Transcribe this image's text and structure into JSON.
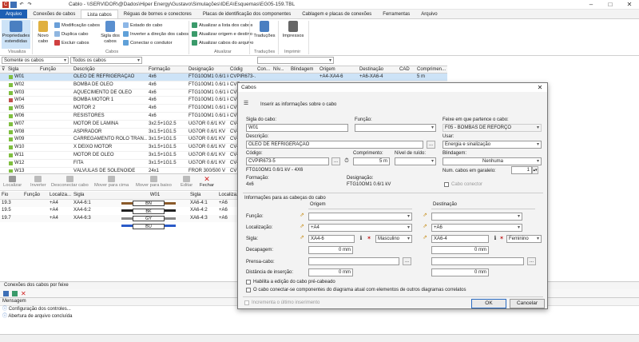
{
  "window": {
    "title": "Cablo - \\\\SERVIDOR\\@Dados\\Hiper Energy\\Gustavo\\Simulações\\IDEA\\Esquemas\\EG05-159.TBL"
  },
  "tabs": [
    "Arquivo",
    "Conexões de cabos",
    "Lista cabos",
    "Réguas de bornes e conectores",
    "Placas de identificação dos componentes",
    "Cablagem e placas de conexões",
    "Ferramentas",
    "Arquivo"
  ],
  "ribbon": {
    "props": "Propriedades estendidas",
    "new_cable": "Novo cabo",
    "mod": "Modificação cabos",
    "dup": "Duplica cabo",
    "del": "Excluir cabos",
    "sigla": "Sigla dos cabos",
    "state": "Estado do cabo",
    "invert": "Inverter a direção dos cabos",
    "connect": "Conectar o condutor",
    "upd_list": "Atualizar a lista dos cabos",
    "upd_orig": "Atualizar origem e destino",
    "upd_file": "Atualizar cabos do arquivo",
    "translations": "Traduções",
    "print": "Impressos",
    "g_view": "Visualiza",
    "g_cables": "Cabos",
    "g_update": "Atualizar",
    "g_trans": "Traduções",
    "g_print": "Imprimir"
  },
  "filters": {
    "left": "Somente os cabos",
    "right": "Todos os cabos"
  },
  "cable_columns": [
    "Sigla",
    "Função",
    "Descrição",
    "Formação",
    "Designação",
    "Códig",
    "Con...",
    "Nív...",
    "Blindagem",
    "Origem",
    "Destinação",
    "CAD",
    "Comprimen..."
  ],
  "cables": [
    {
      "sigla": "W01",
      "desc": "ÓLEO DE REFRIGERAÇÃO",
      "form": "4x6",
      "design": "FTG10OM1 0.6/1 kV",
      "cod": "CVPIR673-..",
      "orig": "+A4-XA4-6",
      "dest": "+A6-XA6-4",
      "len": "5 m",
      "color": "#7fbf3f"
    },
    {
      "sigla": "W02",
      "desc": "BOMBA DE ÓLEO",
      "form": "4x6",
      "design": "FTG10OM1 0.6/1 kV",
      "cod": "CVF",
      "orig": "",
      "dest": "",
      "len": "",
      "color": "#7fbf3f"
    },
    {
      "sigla": "W03",
      "desc": "AQUECIMENTO DE ÓLEO",
      "form": "4x6",
      "design": "FTG10OM1 0.6/1 kV",
      "cod": "CVF",
      "orig": "",
      "dest": "",
      "len": "",
      "color": "#7fbf3f"
    },
    {
      "sigla": "W04",
      "desc": "BOMBA MOTOR 1",
      "form": "4x6",
      "design": "FTG10OM1 0.6/1 kV",
      "cod": "CVF",
      "orig": "",
      "dest": "",
      "len": "",
      "color": "#c0504d"
    },
    {
      "sigla": "W05",
      "desc": "MOTOR 2",
      "form": "4x6",
      "design": "FTG10OM1 0.6/1 kV",
      "cod": "CVF",
      "orig": "",
      "dest": "",
      "len": "",
      "color": "#7fbf3f"
    },
    {
      "sigla": "W06",
      "desc": "RESISTORES",
      "form": "4x6",
      "design": "FTG10OM1 0.6/1 kV",
      "cod": "CVF",
      "orig": "",
      "dest": "",
      "len": "",
      "color": "#7fbf3f"
    },
    {
      "sigla": "W07",
      "desc": "MOTOR DE LÂMINA",
      "form": "3x2.5+1G2.5",
      "design": "UG7OR 0.6/1 KV",
      "cod": "CV4",
      "orig": "",
      "dest": "",
      "len": "",
      "color": "#7fbf3f"
    },
    {
      "sigla": "W08",
      "desc": "ASPIRADOR",
      "form": "3x1.5+1G1.5",
      "design": "UG7OR 0.6/1 KV",
      "cod": "CV4",
      "orig": "",
      "dest": "",
      "len": "",
      "color": "#7fbf3f"
    },
    {
      "sigla": "W09",
      "desc": "CARREGAMENTO ROLO TRAN...",
      "form": "3x1.5+1G1.5",
      "design": "UG7OR 0.6/1 KV",
      "cod": "CV4",
      "orig": "",
      "dest": "",
      "len": "",
      "color": "#7fbf3f"
    },
    {
      "sigla": "W10",
      "desc": "X DEIXO MOTOR",
      "form": "3x1.5+1G1.5",
      "design": "UG7OR 0.6/1 KV",
      "cod": "CV4",
      "orig": "",
      "dest": "",
      "len": "",
      "color": "#7fbf3f"
    },
    {
      "sigla": "W11",
      "desc": "MOTOR DE ÓLEO",
      "form": "3x1.5+1G1.5",
      "design": "UG7OR 0.6/1 KV",
      "cod": "CV4",
      "orig": "",
      "dest": "",
      "len": "",
      "color": "#7fbf3f"
    },
    {
      "sigla": "W12",
      "desc": "FITA",
      "form": "3x1.5+1G1.5",
      "design": "UG7OR 0.6/1 KV",
      "cod": "CV4",
      "orig": "",
      "dest": "",
      "len": "",
      "color": "#7fbf3f"
    },
    {
      "sigla": "W13",
      "desc": "VÁLVULAS DE SOLENÓIDE",
      "form": "24x1",
      "design": "FROR 300/500 V",
      "cod": "CV",
      "orig": "",
      "dest": "",
      "len": "",
      "color": "#7fbf3f"
    }
  ],
  "bottom_toolbar": [
    "Localizar",
    "Inverter",
    "Desconectar cabo",
    "Mover para cima",
    "Mover para baixo",
    "Editar",
    "Fechar"
  ],
  "wire_columns": [
    "Fio",
    "Função",
    "Localiza...",
    "Sigla",
    "W01",
    "Sigla",
    "Localiza..."
  ],
  "wires": [
    {
      "fio": "19.3",
      "loc": "+A4",
      "sigla": "XA4-6:1",
      "bn": "BN",
      "sig2": "XA6-4:1",
      "loc2": "+A6"
    },
    {
      "fio": "19.5",
      "loc": "+A4",
      "sigla": "XA4-6:2",
      "bn": "BK",
      "sig2": "XA6-4:2",
      "loc2": "+A6"
    },
    {
      "fio": "19.7",
      "loc": "+A4",
      "sigla": "XA4-6:3",
      "bn": "GY",
      "sig2": "XA6-4:3",
      "loc2": "+A6"
    },
    {
      "fio": "",
      "loc": "",
      "sigla": "",
      "bn": "BU",
      "sig2": "",
      "loc2": ""
    }
  ],
  "bottom_tab": "Conexões dos cabos por feixe",
  "messages": {
    "header": "Mensagem",
    "lines": [
      "Configuração dos controles...",
      "Abertura de arquivo concluída"
    ]
  },
  "dialog": {
    "title": "Cabos",
    "intro": "Inserir as informações sobre o cabo",
    "sigla_label": "Sigla do cabo:",
    "sigla": "W01",
    "funcao_label": "Função:",
    "funcao": "",
    "feixe_label": "Feixe em que partence o cabo:",
    "feixe": "F05 - BOMBAS DE REFORÇO",
    "desc_label": "Descrição:",
    "desc": "ÓLEO DE REFRIGERAÇÃO",
    "usar_label": "Usar:",
    "usar": "Energia e sinalização",
    "codigo_label": "Código:",
    "codigo": "CVPIR673-5",
    "comp_label": "Comprimento:",
    "comp": "5 m",
    "nivel_label": "Nível de ruído:",
    "nivel": "",
    "blind_label": "Blindagem:",
    "blind": "Nenhuma",
    "codigo_desc": "FTG10OM1 0.6/1 kV - 4X6",
    "num_label": "Num. cabos em garalelo:",
    "num": "1",
    "form_label": "Formação:",
    "form": "4x6",
    "design_label": "Designação:",
    "design": "FTG10OM1 0.6/1 kV",
    "conector": "Cabo conector",
    "heads_label": "Informações para as cabeças do cabo",
    "origem": "Origem",
    "destino": "Destinação",
    "funcao2": "Função:",
    "local": "Localização:",
    "sigla2": "Sigla:",
    "decap": "Decapagem:",
    "prensa": "Prensa-cabo:",
    "dist": "Distância de inserção:",
    "o_local": "+A4",
    "o_sigla": "XA4-6",
    "o_gender": "Masculino",
    "o_decap": "0 mm",
    "o_dist": "0 mm",
    "d_local": "+A6",
    "d_sigla": "XA6-4",
    "d_gender": "Feminino",
    "d_decap": "0 mm",
    "d_dist": "0 mm",
    "chk1": "Habilita a edição do cabo pré-cabeado",
    "chk2": "O cabo conectar-se componentes do diagrama atual com elementos de outros diagramas correlatos",
    "chk3": "Incrementa o último inserimento",
    "ok": "OK",
    "cancel": "Cancelar"
  }
}
